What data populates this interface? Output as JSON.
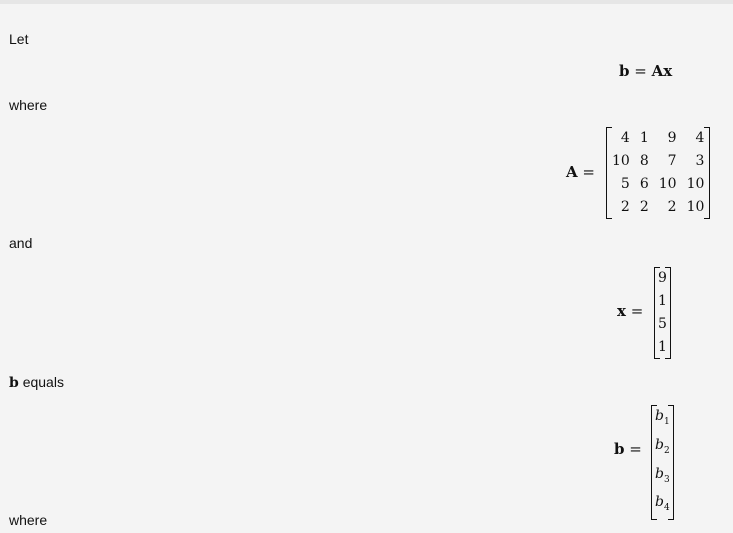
{
  "paragraphs": [
    "Let",
    "where",
    "and",
    "equals",
    "where"
  ],
  "bold_b": "b",
  "equation": {
    "lhs": "b",
    "eq": "=",
    "rhs": "Ax"
  },
  "matrix_A": {
    "label": "A",
    "eq": "=",
    "rows": [
      [
        "4",
        "1",
        "9",
        "4"
      ],
      [
        "10",
        "8",
        "7",
        "3"
      ],
      [
        "5",
        "6",
        "10",
        "10"
      ],
      [
        "2",
        "2",
        "2",
        "10"
      ]
    ]
  },
  "vector_x": {
    "label": "x",
    "eq": "=",
    "values": [
      "9",
      "1",
      "5",
      "1"
    ]
  },
  "vector_b": {
    "label": "b",
    "eq": "=",
    "values": [
      "b",
      "b",
      "b",
      "b"
    ],
    "subs": [
      "1",
      "2",
      "3",
      "4"
    ]
  }
}
